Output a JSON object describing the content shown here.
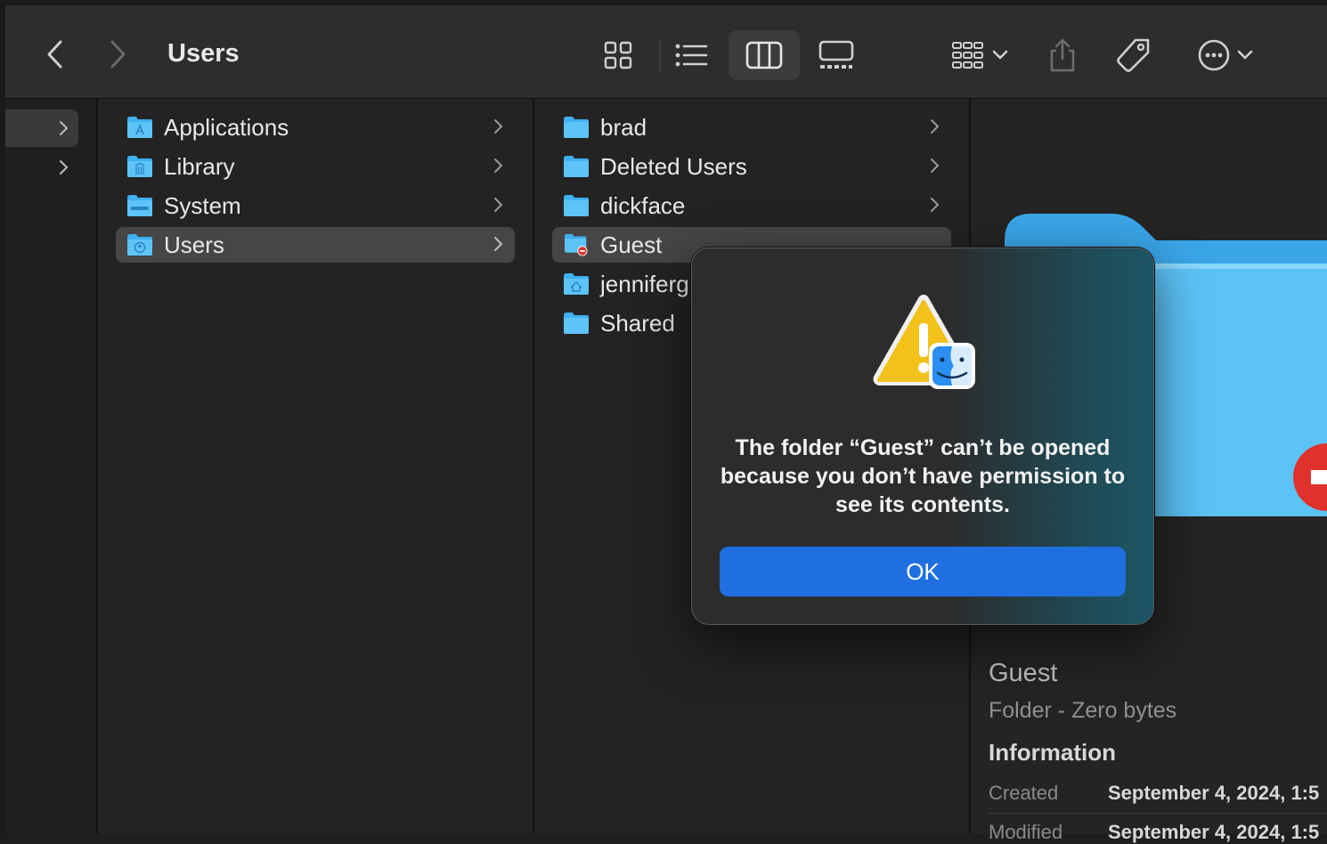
{
  "window": {
    "title": "Users"
  },
  "toolbar": {
    "back_icon": "chevron-left-icon",
    "forward_icon": "chevron-right-icon",
    "view_modes": [
      "icon-view",
      "list-view",
      "column-view",
      "gallery-view"
    ],
    "active_view": "column-view"
  },
  "columns": {
    "root": {
      "items": [
        {
          "name": "Applications",
          "icon": "applications-folder-icon"
        },
        {
          "name": "Library",
          "icon": "library-folder-icon"
        },
        {
          "name": "System",
          "icon": "system-folder-icon"
        },
        {
          "name": "Users",
          "icon": "users-folder-icon",
          "selected": true
        }
      ]
    },
    "users": {
      "items": [
        {
          "name": "brad",
          "has_children": true
        },
        {
          "name": "Deleted Users",
          "has_children": true
        },
        {
          "name": "dickface",
          "has_children": true
        },
        {
          "name": "Guest",
          "selected": true,
          "restricted": true
        },
        {
          "name": "jenniferg"
        },
        {
          "name": "Shared"
        }
      ]
    }
  },
  "preview": {
    "name": "Guest",
    "kind": "Folder - Zero bytes",
    "info_heading": "Information",
    "created_label": "Created",
    "created_value": "September 4, 2024, 1:5",
    "modified_label": "Modified",
    "modified_value": "September 4, 2024, 1:5"
  },
  "dialog": {
    "message": "The folder “Guest” can’t be opened because you don’t have permission to see its contents.",
    "ok_label": "OK"
  },
  "colors": {
    "accent": "#1f6fe0",
    "folder_blue": "#3fb0f0",
    "selection": "#464646",
    "restricted_red": "#e0322c"
  }
}
